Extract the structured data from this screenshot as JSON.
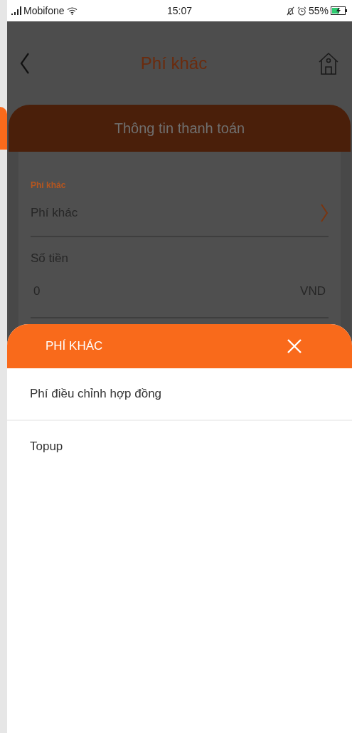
{
  "status_bar": {
    "carrier": "Mobifone",
    "time": "15:07",
    "battery": "55%"
  },
  "nav": {
    "title": "Phí khác"
  },
  "card": {
    "title": "Thông tin thanh toán",
    "fields": [
      {
        "kind": "select",
        "label": "Phí khác",
        "value": "Phí khác"
      },
      {
        "kind": "amount",
        "label": "Số tiền",
        "value": "0",
        "unit": "VND"
      }
    ]
  },
  "sheet": {
    "title": "PHÍ KHÁC",
    "options": [
      {
        "label": "Phí điều chỉnh hợp đồng"
      },
      {
        "label": "Topup"
      }
    ]
  }
}
